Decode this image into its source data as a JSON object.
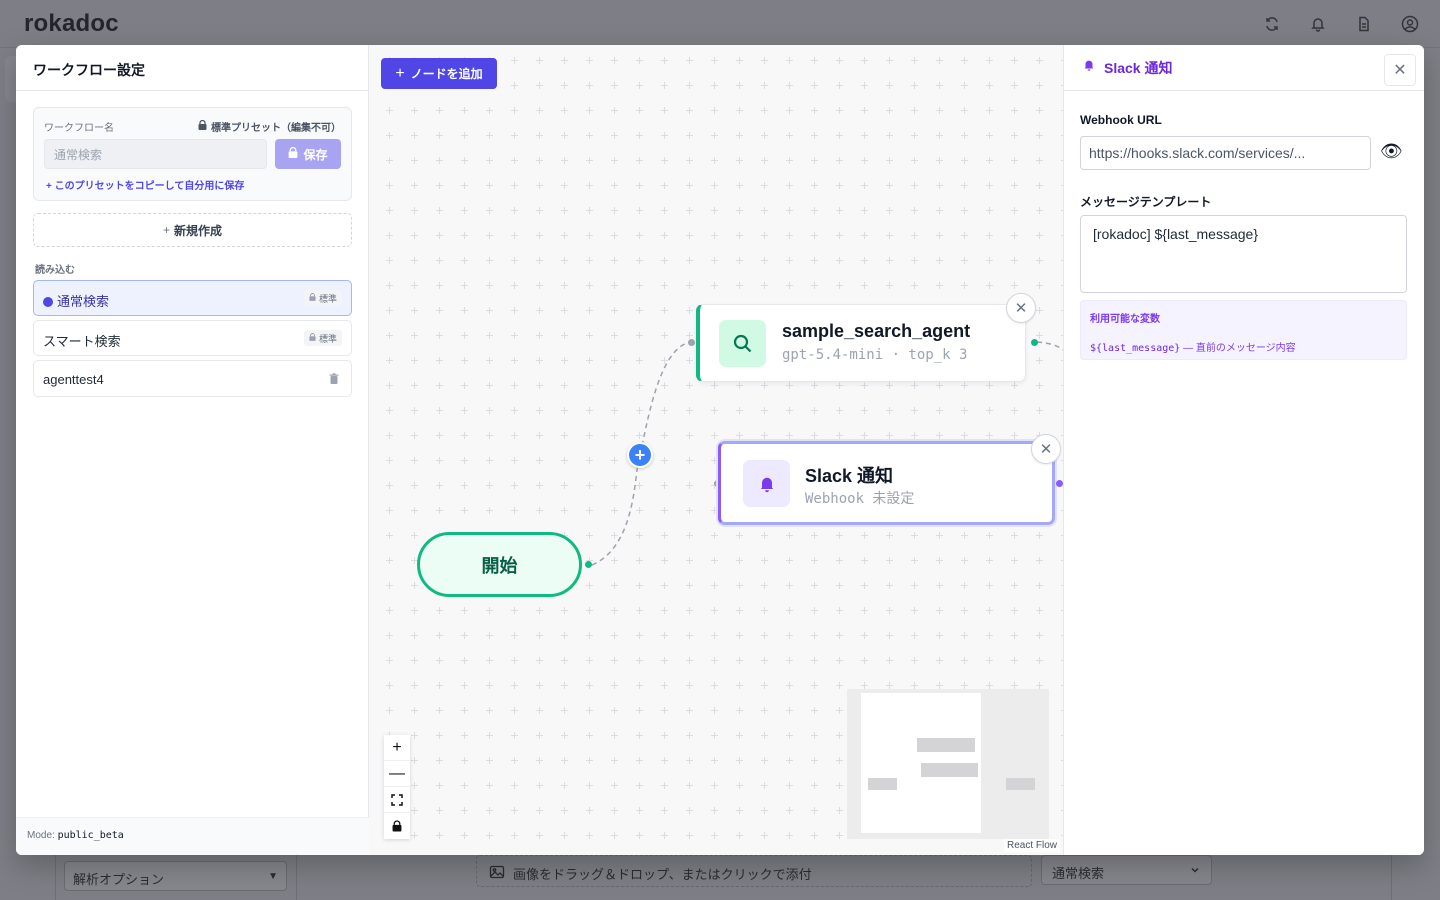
{
  "background": {
    "app_name": "rokadoc",
    "parse_option": "解析オプション",
    "drop_hint": "画像をドラッグ＆ドロップ、またはクリックで添付",
    "search_mode": "通常検索"
  },
  "left_panel": {
    "title": "ワークフロー設定",
    "name_label": "ワークフロー名",
    "preset_note": "標準プリセット（編集不可）",
    "name_value": "通常検索",
    "save_label": "保存",
    "copy_link": "このプリセットをコピーして自分用に保存",
    "new_label": "新規作成",
    "load_label": "読み込む",
    "workflows": [
      {
        "name": "通常検索",
        "badge": "標準",
        "active": true
      },
      {
        "name": "スマート検索",
        "badge": "標準",
        "active": false
      },
      {
        "name": "agenttest4",
        "badge": "",
        "active": false
      }
    ],
    "mode_label": "Mode:",
    "mode_value": "public_beta"
  },
  "canvas": {
    "add_node_label": "ノードを追加",
    "start_label": "開始",
    "agent_node": {
      "title": "sample_search_agent",
      "subtitle": "gpt-5.4-mini · top_k 3"
    },
    "slack_node": {
      "title": "Slack 通知",
      "subtitle": "Webhook 未設定"
    },
    "attribution": "React Flow"
  },
  "right_panel": {
    "title": "Slack 通知",
    "webhook_label": "Webhook URL",
    "webhook_value": "https://hooks.slack.com/services/...",
    "template_label": "メッセージテンプレート",
    "template_value": "[rokadoc] ${last_message}",
    "vars_title": "利用可能な変数",
    "var_name": "${last_message}",
    "var_desc": " — 直前のメッセージ内容"
  },
  "colors": {
    "primary": "#4f46e5",
    "agent_accent": "#10b981",
    "slack_accent": "#8b5cf6"
  }
}
